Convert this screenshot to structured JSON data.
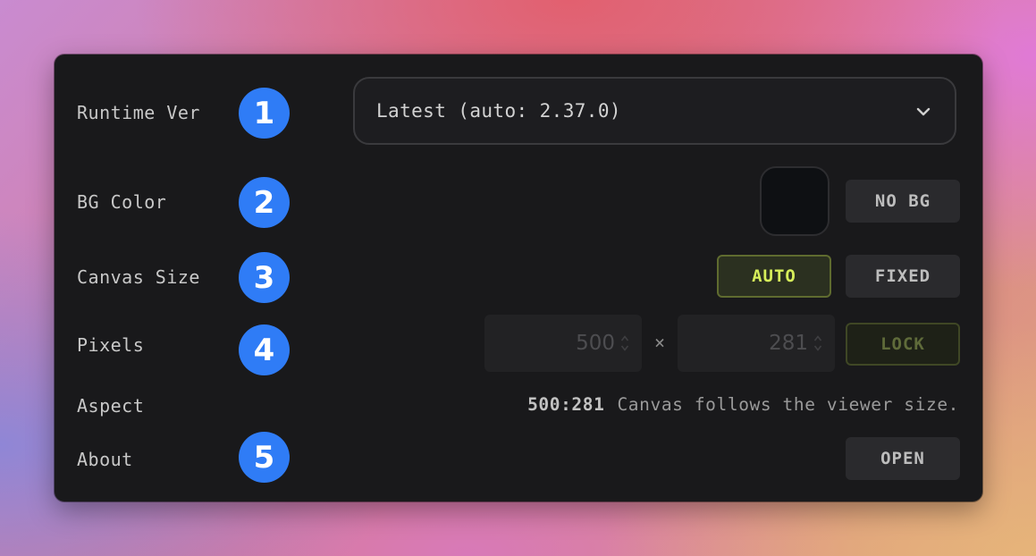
{
  "rows": {
    "runtime": {
      "label": "Runtime Ver",
      "badge": "1",
      "value": "Latest (auto: 2.37.0)"
    },
    "bg_color": {
      "label": "BG Color",
      "badge": "2",
      "no_bg_label": "NO BG",
      "swatch_color": "#0e1013"
    },
    "canvas_size": {
      "label": "Canvas Size",
      "badge": "3",
      "auto_label": "AUTO",
      "fixed_label": "FIXED",
      "selected": "AUTO"
    },
    "pixels": {
      "label": "Pixels",
      "badge": "4",
      "width": "500",
      "height": "281",
      "separator": "×",
      "lock_label": "LOCK"
    },
    "aspect": {
      "label": "Aspect",
      "ratio": "500:281",
      "note": "Canvas follows the viewer size."
    },
    "about": {
      "label": "About",
      "badge": "5",
      "open_label": "OPEN"
    }
  },
  "colors": {
    "badge": "#2f7cf6",
    "accent": "#d6ee5a",
    "panel": "#19191b"
  }
}
